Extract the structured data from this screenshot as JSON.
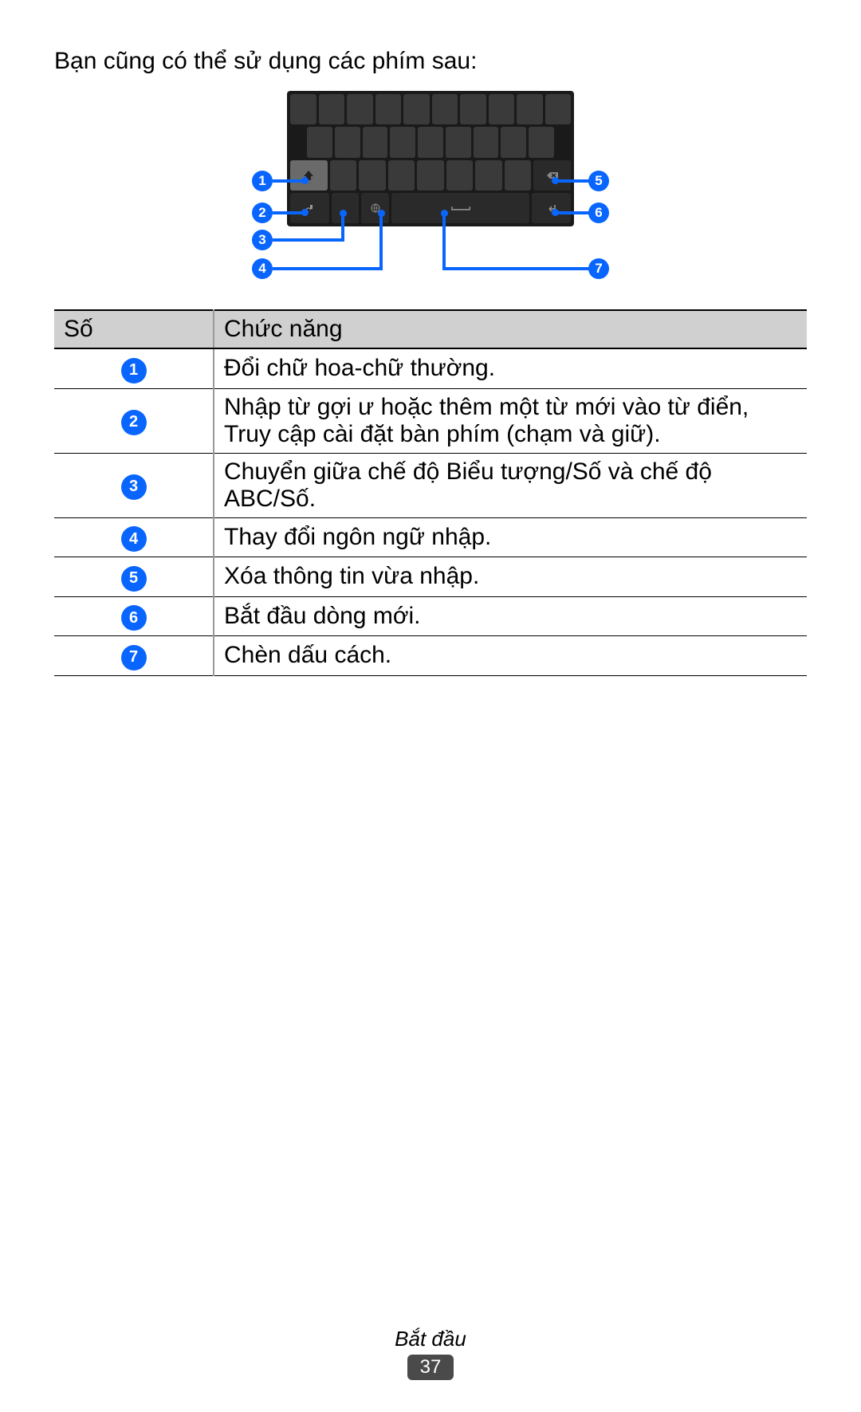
{
  "intro": "Bạn cũng có thể sử dụng các phím sau:",
  "callouts": [
    "1",
    "2",
    "3",
    "4",
    "5",
    "6",
    "7"
  ],
  "table": {
    "headers": [
      "Số",
      "Chức năng"
    ],
    "rows": [
      {
        "num": "1",
        "desc": "Đổi chữ hoa-chữ thường."
      },
      {
        "num": "2",
        "desc": "Nhập từ gợi ư hoặc thêm một từ mới vào từ điển, Truy cập cài đặt bàn phím (chạm và giữ)."
      },
      {
        "num": "3",
        "desc": "Chuyển giữa chế độ Biểu tượng/Số và chế độ ABC/Số."
      },
      {
        "num": "4",
        "desc": "Thay đổi ngôn ngữ nhập."
      },
      {
        "num": "5",
        "desc": "Xóa thông tin vừa nhập."
      },
      {
        "num": "6",
        "desc": "Bắt đầu dòng mới."
      },
      {
        "num": "7",
        "desc": "Chèn dấu cách."
      }
    ]
  },
  "footer": {
    "section": "Bắt đầu",
    "page": "37"
  }
}
